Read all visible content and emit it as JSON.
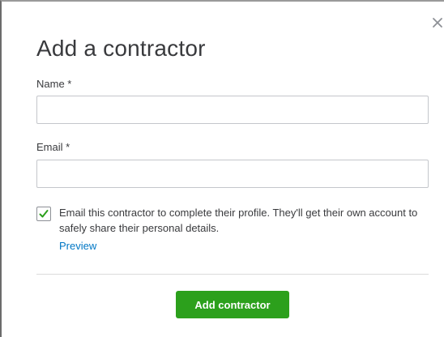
{
  "dialog": {
    "title": "Add a contractor",
    "close_icon": "close-icon",
    "name_field": {
      "label": "Name *",
      "value": "",
      "placeholder": ""
    },
    "email_field": {
      "label": "Email *",
      "value": "",
      "placeholder": ""
    },
    "invite_checkbox": {
      "checked": true,
      "text": "Email this contractor to complete their profile. They'll get their own account to safely share their personal details.",
      "link_label": "Preview"
    },
    "submit_label": "Add contractor"
  },
  "colors": {
    "primary_green": "#2ca01c",
    "link_blue": "#0077c5",
    "text": "#393a3d",
    "input_border": "#c4c6cb"
  }
}
